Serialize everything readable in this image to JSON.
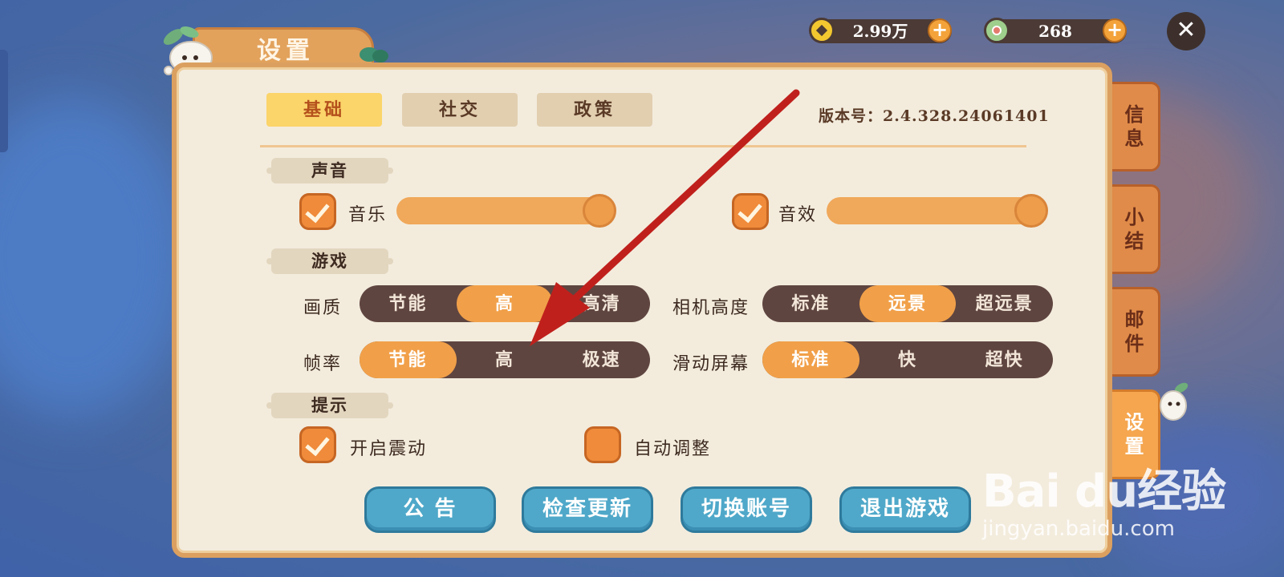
{
  "window": {
    "title": "设置"
  },
  "currency": {
    "gold": {
      "value": "2.99万",
      "icon": "gold-coin-icon"
    },
    "jade": {
      "value": "268",
      "icon": "jade-coin-icon"
    }
  },
  "tabs": [
    {
      "label": "基础",
      "active": true
    },
    {
      "label": "社交",
      "active": false
    },
    {
      "label": "政策",
      "active": false
    }
  ],
  "version": "版本号：2.4.328.24061401",
  "side_tabs": [
    {
      "label": "信息",
      "active": false
    },
    {
      "label": "小结",
      "active": false
    },
    {
      "label": "邮件",
      "active": false
    },
    {
      "label": "设置",
      "active": true
    }
  ],
  "sections": {
    "sound": "声音",
    "game": "游戏",
    "tips": "提示"
  },
  "sound": {
    "music": {
      "label": "音乐",
      "checked": true,
      "level": 1.0
    },
    "sfx": {
      "label": "音效",
      "checked": true,
      "level": 1.0
    }
  },
  "game": {
    "quality": {
      "label": "画质",
      "options": [
        "节能",
        "高",
        "高清"
      ],
      "selected": 1
    },
    "camera": {
      "label": "相机高度",
      "options": [
        "标准",
        "远景",
        "超远景"
      ],
      "selected": 1
    },
    "framerate": {
      "label": "帧率",
      "options": [
        "节能",
        "高",
        "极速"
      ],
      "selected": 0
    },
    "scroll": {
      "label": "滑动屏幕",
      "options": [
        "标准",
        "快",
        "超快"
      ],
      "selected": 0
    }
  },
  "tips": {
    "vibrate": {
      "label": "开启震动",
      "checked": true
    },
    "auto_adjust": {
      "label": "自动调整",
      "checked": false
    }
  },
  "buttons": {
    "notice": "公 告",
    "update": "检查更新",
    "switch": "切换账号",
    "exit": "退出游戏"
  },
  "watermark": {
    "logo": "Bai du经验",
    "url": "jingyan.baidu.com"
  },
  "colors": {
    "accent": "#f1a049",
    "button": "#4fa8c9",
    "annotation_arrow": "#c0201c"
  }
}
